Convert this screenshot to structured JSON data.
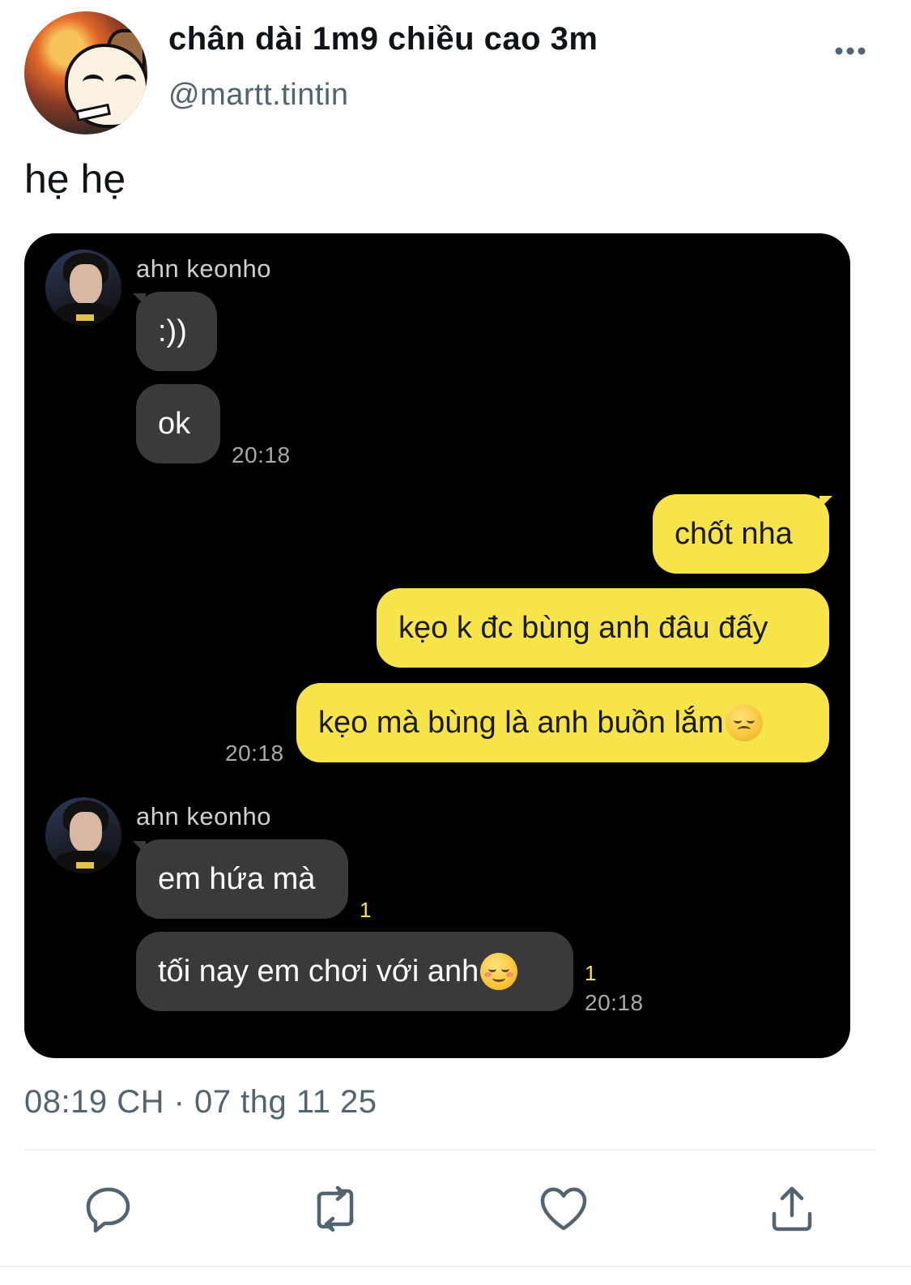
{
  "tweet": {
    "display_name": "chân dài 1m9 chiều cao 3m",
    "handle": "@martt.tintin",
    "more_icon": "more-dots-icon",
    "text": "hẹ hẹ",
    "timestamp": "08:19 CH · 07 thg 11 25"
  },
  "chat": {
    "messages_group_1": {
      "sender": "ahn keonho",
      "bubbles": [
        ":))",
        "ok"
      ],
      "time": "20:18"
    },
    "messages_group_2": {
      "bubbles": [
        "chốt nha",
        "kẹo k đc bùng anh đâu đấy",
        "kẹo mà bùng là anh buồn lắm"
      ],
      "time": "20:18",
      "emoji": "disappointed-face-emoji"
    },
    "messages_group_3": {
      "sender": "ahn keonho",
      "bubbles": [
        "em hứa mà",
        "tối nay em chơi với anh"
      ],
      "unread_1": "1",
      "unread_2": "1",
      "time": "20:18",
      "emoji": "smiling-face-emoji"
    },
    "colors": {
      "background": "#000000",
      "incoming_bubble": "#3a3a3c",
      "outgoing_bubble": "#f7e34a"
    }
  },
  "actions": [
    {
      "icon": "reply-icon"
    },
    {
      "icon": "retweet-icon"
    },
    {
      "icon": "like-icon"
    },
    {
      "icon": "share-icon"
    }
  ]
}
